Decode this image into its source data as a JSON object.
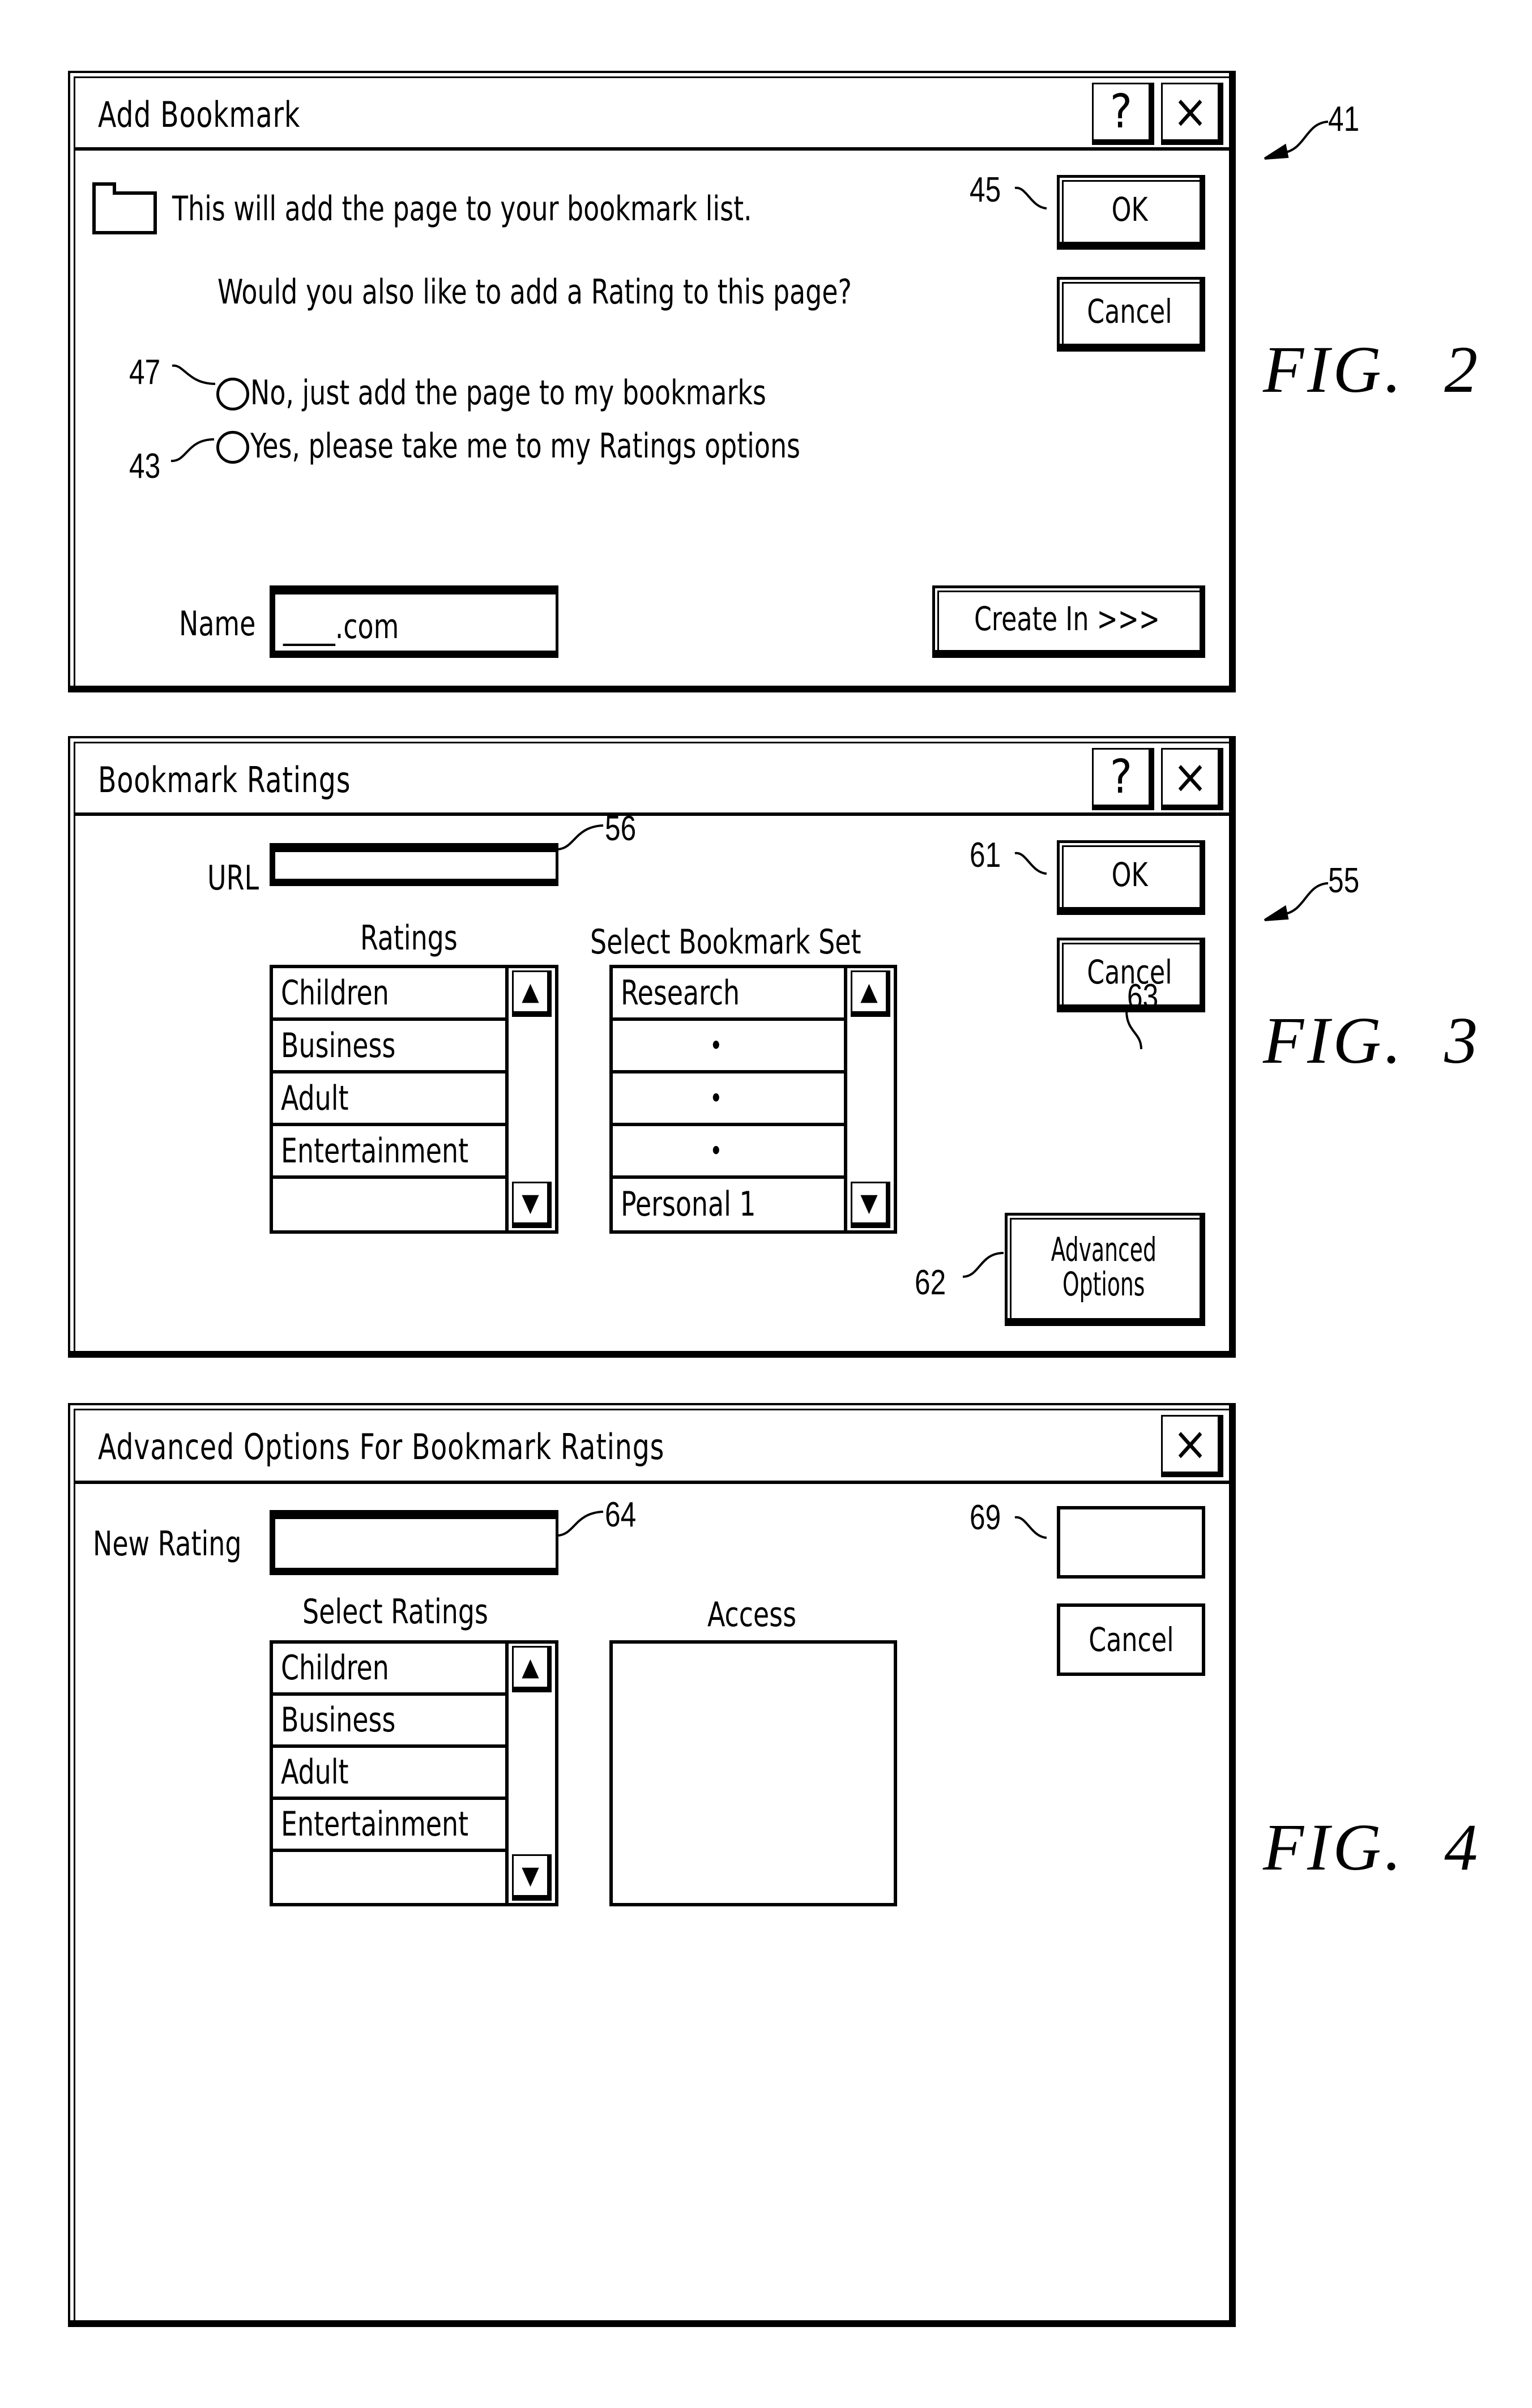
{
  "figures": [
    {
      "figure_label": "FIG.",
      "figure_number": "2",
      "reference_numeral": "41",
      "window": {
        "title": "Add Bookmark",
        "title_buttons": [
          "?",
          "×"
        ],
        "folder_message": "This will add the page to your bookmark list.",
        "question": "Would you also like to add a Rating to this page?",
        "radio_options": [
          {
            "label": "No, just add the page to my bookmarks",
            "ref": "47"
          },
          {
            "label": "Yes, please take me to my Ratings options",
            "ref": "43"
          }
        ],
        "ok_button": {
          "label": "OK",
          "ref": "45"
        },
        "cancel_button": {
          "label": "Cancel"
        },
        "name_label": "Name",
        "name_value": "____.com",
        "create_button": {
          "label": "Create In >>>"
        }
      }
    },
    {
      "figure_label": "FIG.",
      "figure_number": "3",
      "reference_numeral": "55",
      "window": {
        "title": "Bookmark Ratings",
        "title_buttons": [
          "?",
          "×"
        ],
        "url_label": "URL",
        "url_value": "",
        "url_ref": "56",
        "ratings_heading": "Ratings",
        "ratings_items": [
          "Children",
          "Business",
          "Adult",
          "Entertainment",
          ""
        ],
        "set_heading": "Select Bookmark Set",
        "set_items": [
          "Research",
          "•",
          "•",
          "•",
          "Personal 1"
        ],
        "ok_button": {
          "label": "OK",
          "ref": "61"
        },
        "cancel_button": {
          "label": "Cancel",
          "ref": "63"
        },
        "advanced_button": {
          "label_line1": "Advanced",
          "label_line2": "Options",
          "ref": "62"
        }
      }
    },
    {
      "figure_label": "FIG.",
      "figure_number": "4",
      "window": {
        "title": "Advanced Options For Bookmark Ratings",
        "title_buttons": [
          "×"
        ],
        "new_rating_label": "New Rating",
        "new_rating_value": "",
        "new_rating_ref": "64",
        "select_ratings_heading": "Select Ratings",
        "select_ratings_items": [
          "Children",
          "Business",
          "Adult",
          "Entertainment",
          ""
        ],
        "access_heading": "Access",
        "access_items": [],
        "blank_button": {
          "label": "",
          "ref": "69"
        },
        "cancel_button": {
          "label": "Cancel"
        }
      }
    }
  ],
  "scroll_glyphs": {
    "up": "▲",
    "down": "▼"
  }
}
